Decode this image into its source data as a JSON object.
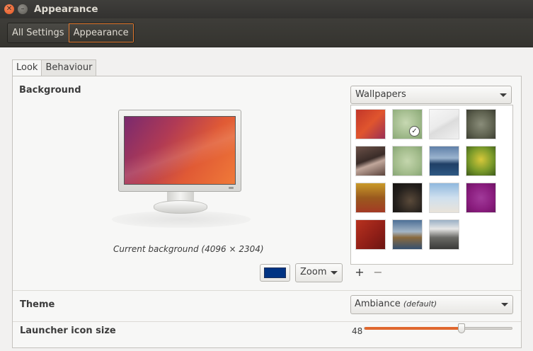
{
  "window": {
    "title": "Appearance"
  },
  "breadcrumbs": [
    "All Settings",
    "Appearance"
  ],
  "tabs": [
    "Look",
    "Behaviour"
  ],
  "background": {
    "label": "Background",
    "caption": "Current background (4096 × 2304)",
    "source_selected": "Wallpapers",
    "color_value": "#003383",
    "scaling_selected": "Zoom",
    "add_label": "+",
    "remove_label": "−",
    "thumbnails": [
      {
        "name": "wallpaper-warty-final",
        "selected": false
      },
      {
        "name": "wallpaper-plant",
        "selected": true
      },
      {
        "name": "wallpaper-light-grey",
        "selected": false
      },
      {
        "name": "wallpaper-leaf-macro",
        "selected": false
      },
      {
        "name": "wallpaper-architecture",
        "selected": false
      },
      {
        "name": "wallpaper-plant-2",
        "selected": false
      },
      {
        "name": "wallpaper-lake",
        "selected": false
      },
      {
        "name": "wallpaper-butterfly",
        "selected": false
      },
      {
        "name": "wallpaper-autumn",
        "selected": false
      },
      {
        "name": "wallpaper-night-lights",
        "selected": false
      },
      {
        "name": "wallpaper-sky-pier",
        "selected": false
      },
      {
        "name": "wallpaper-purple",
        "selected": false
      },
      {
        "name": "wallpaper-red-abstract",
        "selected": false
      },
      {
        "name": "wallpaper-coast",
        "selected": false
      },
      {
        "name": "wallpaper-mountains",
        "selected": false
      }
    ]
  },
  "theme": {
    "label": "Theme",
    "selected_name": "Ambiance",
    "selected_suffix": "(default)"
  },
  "launcher": {
    "label": "Launcher icon size",
    "value": "48",
    "fraction": 0.66
  },
  "colors": {
    "accent": "#e0682f",
    "titlebar": "#3f3e3b"
  }
}
